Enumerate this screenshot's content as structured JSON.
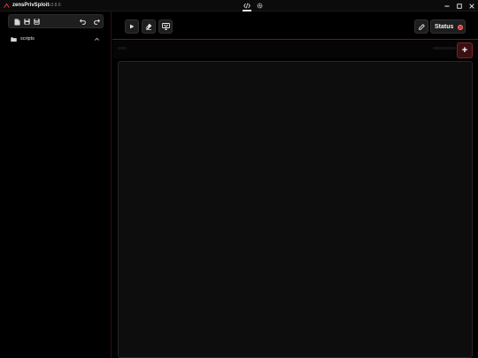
{
  "titlebar": {
    "app_name": "zensPrivSploit",
    "version": "v3.8.6",
    "tabs": [
      {
        "icon": "code-icon",
        "active": true
      },
      {
        "icon": "gear-icon",
        "active": false
      }
    ],
    "window_controls": [
      "minimize-icon",
      "maximize-icon",
      "close-icon"
    ]
  },
  "sidebar": {
    "toolbar_icons": [
      "new-file-icon",
      "save-icon",
      "save-as-icon",
      "undo-icon",
      "redo-icon"
    ],
    "folders": [
      {
        "label": "scripts",
        "expanded": true,
        "icon": "folder-icon"
      }
    ]
  },
  "toolbar": {
    "buttons": [
      "play-icon",
      "eraser-icon",
      "attach-icon",
      "edit-icon"
    ],
    "status_label": "Status",
    "status_color": "#d0383d"
  },
  "tabbar": {
    "add_label": "+"
  },
  "colors": {
    "accent": "#7a2226",
    "background": "#000000",
    "panel": "#1e1e1e",
    "editor": "#0d0d0d"
  }
}
